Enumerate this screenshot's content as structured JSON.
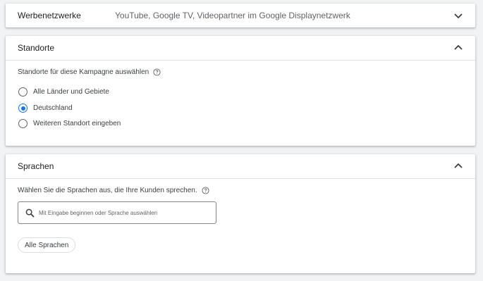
{
  "networks": {
    "title": "Werbenetzwerke",
    "summary": "YouTube, Google TV, Videopartner im Google Displaynetzwerk",
    "expanded": false
  },
  "locations": {
    "title": "Standorte",
    "prompt": "Standorte für diese Kampagne auswählen",
    "expanded": true,
    "options": [
      {
        "label": "Alle Länder und Gebiete",
        "selected": false
      },
      {
        "label": "Deutschland",
        "selected": true
      },
      {
        "label": "Weiteren Standort eingeben",
        "selected": false
      }
    ]
  },
  "languages": {
    "title": "Sprachen",
    "prompt": "Wählen Sie die Sprachen aus, die Ihre Kunden sprechen.",
    "expanded": true,
    "search_placeholder": "Mit Eingabe beginnen oder Sprache auswählen",
    "search_value": "",
    "chip_label": "Alle Sprachen"
  },
  "colors": {
    "accent": "#1a73e8",
    "background": "#f1f3f4",
    "card": "#ffffff",
    "text": "#3c4043"
  },
  "icons": [
    "chevron-down-icon",
    "chevron-up-icon",
    "help-icon",
    "search-icon"
  ]
}
